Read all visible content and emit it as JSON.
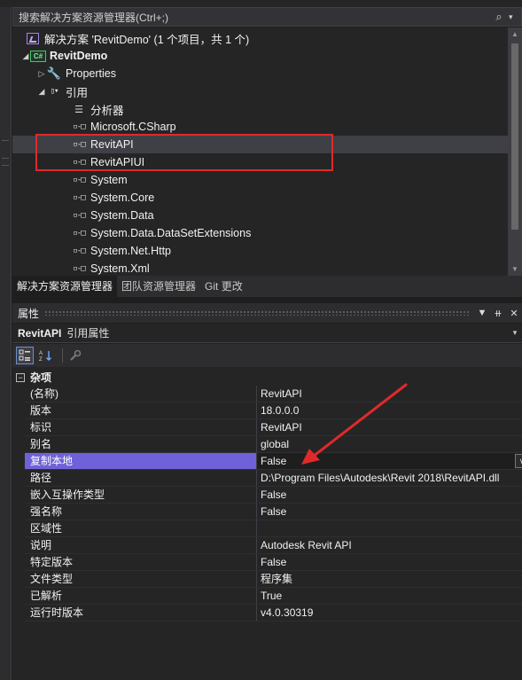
{
  "search": {
    "placeholder": "搜索解决方案资源管理器(Ctrl+;)",
    "icon": "search-icon"
  },
  "tree": {
    "solution": "解决方案 'RevitDemo' (1 个项目，共 1 个)",
    "project": "RevitDemo",
    "project_badge": "C#",
    "properties": "Properties",
    "references": "引用",
    "analyzers": "分析器",
    "refs": [
      "Microsoft.CSharp",
      "RevitAPI",
      "RevitAPIUI",
      "System",
      "System.Core",
      "System.Data",
      "System.Data.DataSetExtensions",
      "System.Net.Http",
      "System.Xml"
    ]
  },
  "tabs": [
    "解决方案资源管理器",
    "团队资源管理器",
    "Git 更改"
  ],
  "properties": {
    "title": "属性",
    "object_name": "RevitAPI",
    "object_type": "引用属性",
    "category": "杂项",
    "rows": [
      {
        "name": "(名称)",
        "value": "RevitAPI"
      },
      {
        "name": "版本",
        "value": "18.0.0.0"
      },
      {
        "name": "标识",
        "value": "RevitAPI"
      },
      {
        "name": "别名",
        "value": "global"
      },
      {
        "name": "复制本地",
        "value": "False"
      },
      {
        "name": "路径",
        "value": "D:\\Program Files\\Autodesk\\Revit 2018\\RevitAPI.dll"
      },
      {
        "name": "嵌入互操作类型",
        "value": "False"
      },
      {
        "name": "强名称",
        "value": "False"
      },
      {
        "name": "区域性",
        "value": ""
      },
      {
        "name": "说明",
        "value": "Autodesk Revit API"
      },
      {
        "name": "特定版本",
        "value": "False"
      },
      {
        "name": "文件类型",
        "value": "程序集"
      },
      {
        "name": "已解析",
        "value": "True"
      },
      {
        "name": "运行时版本",
        "value": "v4.0.30319"
      }
    ]
  },
  "colors": {
    "selected_property": "#6f62d8",
    "highlight_box": "#e02a2a",
    "arrow": "#e02a2a"
  }
}
